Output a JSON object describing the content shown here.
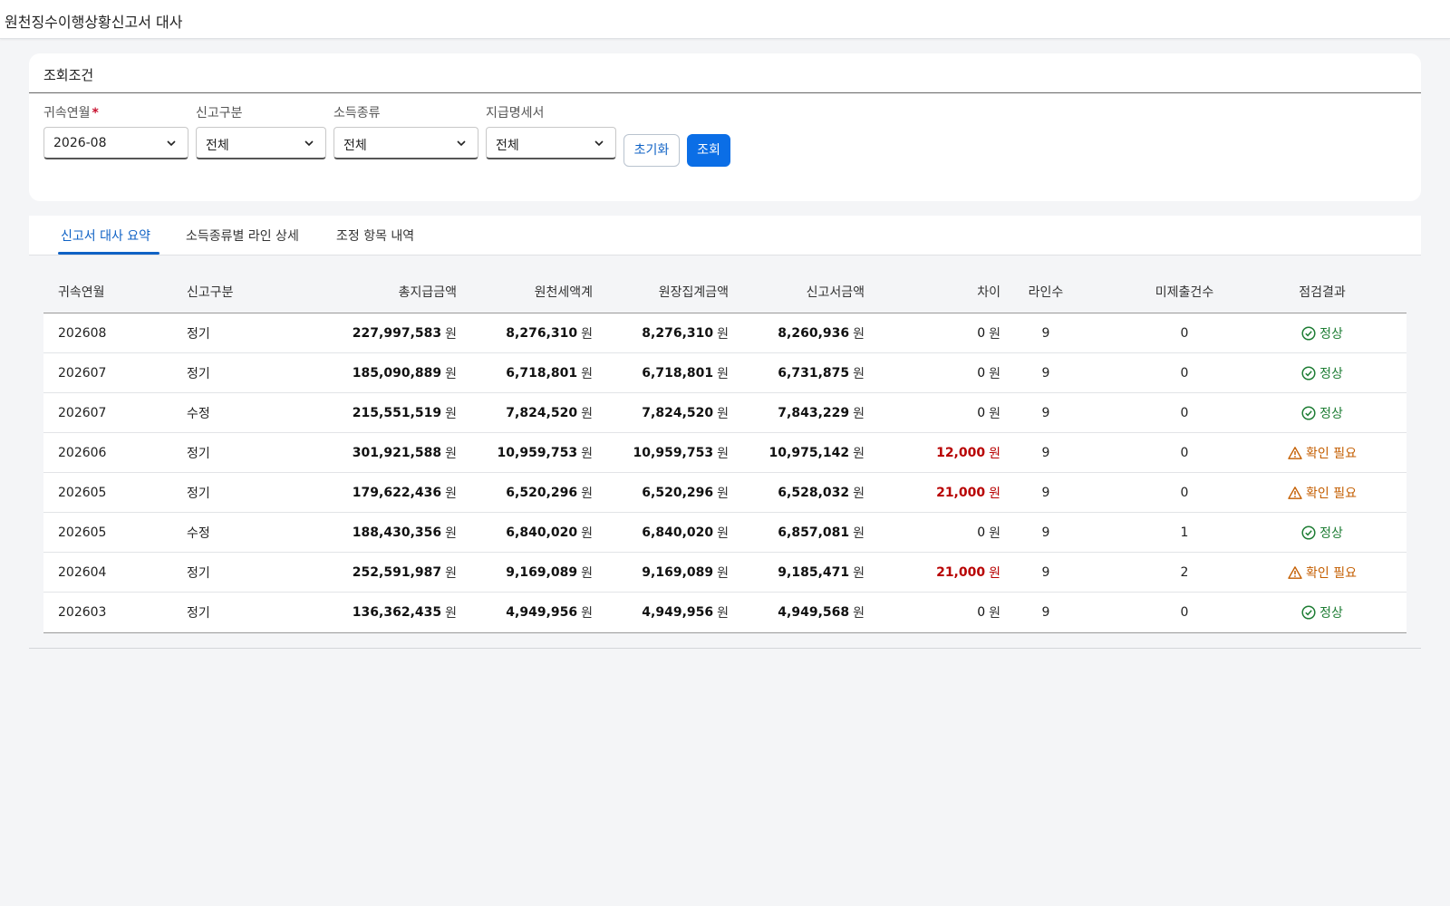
{
  "window_title": "원천징수이행상황신고서 대사",
  "search": {
    "title": "조회조건",
    "fields": [
      {
        "label": "귀속연월",
        "required_mark": "*",
        "value": "2026-08"
      },
      {
        "label": "신고구분",
        "value": "전체"
      },
      {
        "label": "소득종류",
        "value": "전체"
      },
      {
        "label": "지급명세서",
        "value": "전체"
      }
    ],
    "reset_label": "초기화",
    "search_label": "조회"
  },
  "tabs": [
    {
      "label": "신고서 대사 요약",
      "active": true
    },
    {
      "label": "소득종류별 라인 상세",
      "active": false
    },
    {
      "label": "조정 항목 내역",
      "active": false
    }
  ],
  "table": {
    "unit": "원",
    "headers": [
      "귀속연월",
      "신고구분",
      "총지급금액",
      "원천세액계",
      "원장집계금액",
      "신고서금액",
      "차이",
      "라인수",
      "미제출건수",
      "점검결과"
    ],
    "rows": [
      [
        "202608",
        "정기",
        "227,997,583",
        "8,276,310",
        "8,276,310",
        "8,260,936",
        "0",
        "9",
        "0",
        "정상"
      ],
      [
        "202607",
        "정기",
        "185,090,889",
        "6,718,801",
        "6,718,801",
        "6,731,875",
        "0",
        "9",
        "0",
        "정상"
      ],
      [
        "202607",
        "수정",
        "215,551,519",
        "7,824,520",
        "7,824,520",
        "7,843,229",
        "0",
        "9",
        "0",
        "정상"
      ],
      [
        "202606",
        "정기",
        "301,921,588",
        "10,959,753",
        "10,959,753",
        "10,975,142",
        "12,000",
        "9",
        "0",
        "확인 필요"
      ],
      [
        "202605",
        "정기",
        "179,622,436",
        "6,520,296",
        "6,520,296",
        "6,528,032",
        "21,000",
        "9",
        "0",
        "확인 필요"
      ],
      [
        "202605",
        "수정",
        "188,430,356",
        "6,840,020",
        "6,840,020",
        "6,857,081",
        "0",
        "9",
        "1",
        "정상"
      ],
      [
        "202604",
        "정기",
        "252,591,987",
        "9,169,089",
        "9,169,089",
        "9,185,471",
        "21,000",
        "9",
        "2",
        "확인 필요"
      ],
      [
        "202603",
        "정기",
        "136,362,435",
        "4,949,956",
        "4,949,956",
        "4,949,568",
        "0",
        "9",
        "0",
        "정상"
      ]
    ],
    "status_icons": {
      "정상": "check-circle-icon",
      "확인 필요": "warning-triangle-icon"
    },
    "colors": {
      "ok": "#1e7d34",
      "warn": "#c45e00",
      "diff": "#b80000",
      "accent": "#0b6ee6"
    }
  }
}
